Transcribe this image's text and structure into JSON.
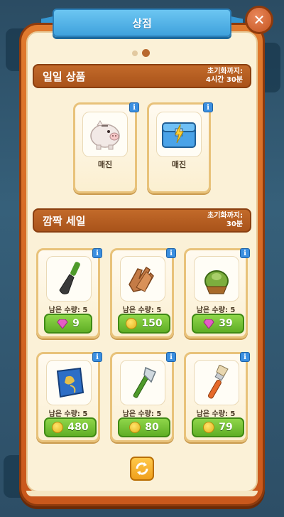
{
  "title": "상점",
  "close_icon": "✕",
  "daily": {
    "title": "일일 상품",
    "reset_label": "초기화까지:",
    "reset_time": "4시간 30분",
    "items": [
      {
        "label": "매진",
        "icon": "piggy-bank-icon"
      },
      {
        "label": "매진",
        "icon": "energy-chest-icon"
      }
    ]
  },
  "flash": {
    "title": "깜짝 세일",
    "reset_label": "초기화까지:",
    "reset_time": "30분",
    "items": [
      {
        "stock": "남은 수량: 5",
        "price": "9",
        "currency": "gem",
        "icon": "trowel-icon"
      },
      {
        "stock": "남은 수량: 5",
        "price": "150",
        "currency": "coin",
        "icon": "gloves-icon"
      },
      {
        "stock": "남은 수량: 5",
        "price": "39",
        "currency": "gem",
        "icon": "plant-pot-icon"
      },
      {
        "stock": "남은 수량: 5",
        "price": "480",
        "currency": "coin",
        "icon": "seed-bag-icon"
      },
      {
        "stock": "남은 수량: 5",
        "price": "80",
        "currency": "coin",
        "icon": "axe-icon"
      },
      {
        "stock": "남은 수량: 5",
        "price": "79",
        "currency": "coin",
        "icon": "paint-brush-icon"
      }
    ]
  },
  "pagination": {
    "current": 2,
    "total": 2
  },
  "colors": {
    "accent": "#3fa2dc",
    "panel": "#e07a2e",
    "buy": "#5fae25"
  }
}
